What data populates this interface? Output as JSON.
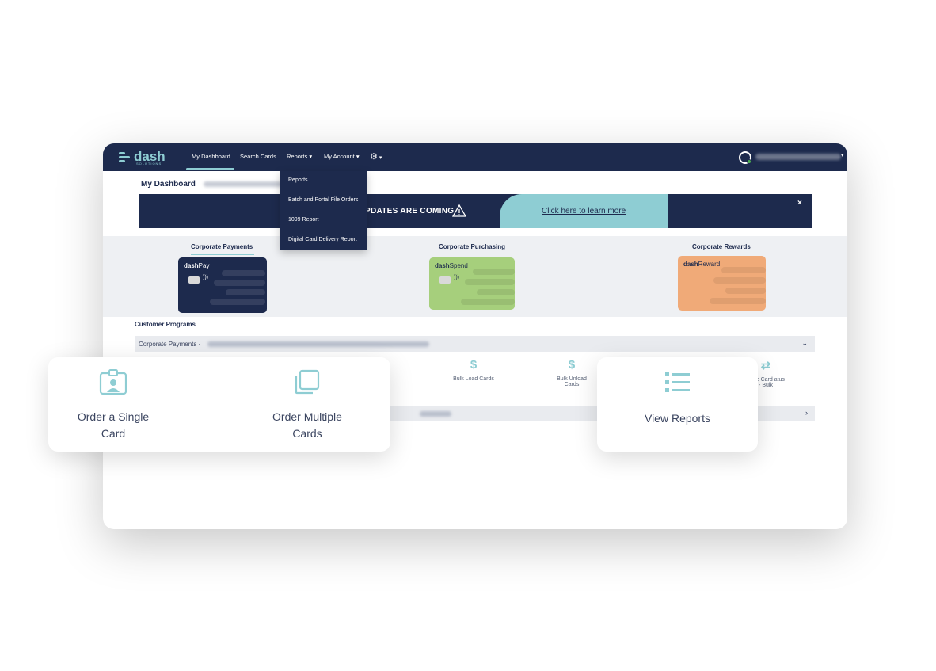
{
  "nav": {
    "logo": "dash",
    "logo_sub": "SOLUTIONS",
    "items": [
      "My Dashboard",
      "Search Cards",
      "Reports",
      "My Account"
    ],
    "settings_icon": "gear-icon"
  },
  "reports_menu": [
    "Reports",
    "Batch and Portal File Orders",
    "1099 Report",
    "Digital Card Delivery Report"
  ],
  "page": {
    "title": "My Dashboard"
  },
  "banner": {
    "text": "PDATES ARE COMING",
    "link": "Click here to learn more",
    "close": "×"
  },
  "programs": [
    {
      "label": "Corporate Payments",
      "brand": "dash",
      "product": "Pay",
      "color": "#1d2a4d"
    },
    {
      "label": "Corporate Purchasing",
      "brand": "dash",
      "product": "Spend",
      "color": "#a6cf7c"
    },
    {
      "label": "Corporate Rewards",
      "brand": "dash",
      "product": "Reward",
      "color": "#f0aa78"
    }
  ],
  "customer_programs": {
    "title": "Customer Programs",
    "accordion_label": "Corporate Payments -",
    "actions": [
      {
        "icon": "$",
        "label": "Bulk Load Cards"
      },
      {
        "icon": "$",
        "label": "Bulk Unload Cards"
      },
      {
        "icon": "⇄",
        "label": "ange Card atus - Bulk"
      }
    ]
  },
  "floating": {
    "order_single": "Order a Single Card",
    "order_multiple": "Order Multiple Cards",
    "view_reports": "View Reports"
  },
  "colors": {
    "navy": "#1d2a4d",
    "teal": "#8ecdd3"
  }
}
